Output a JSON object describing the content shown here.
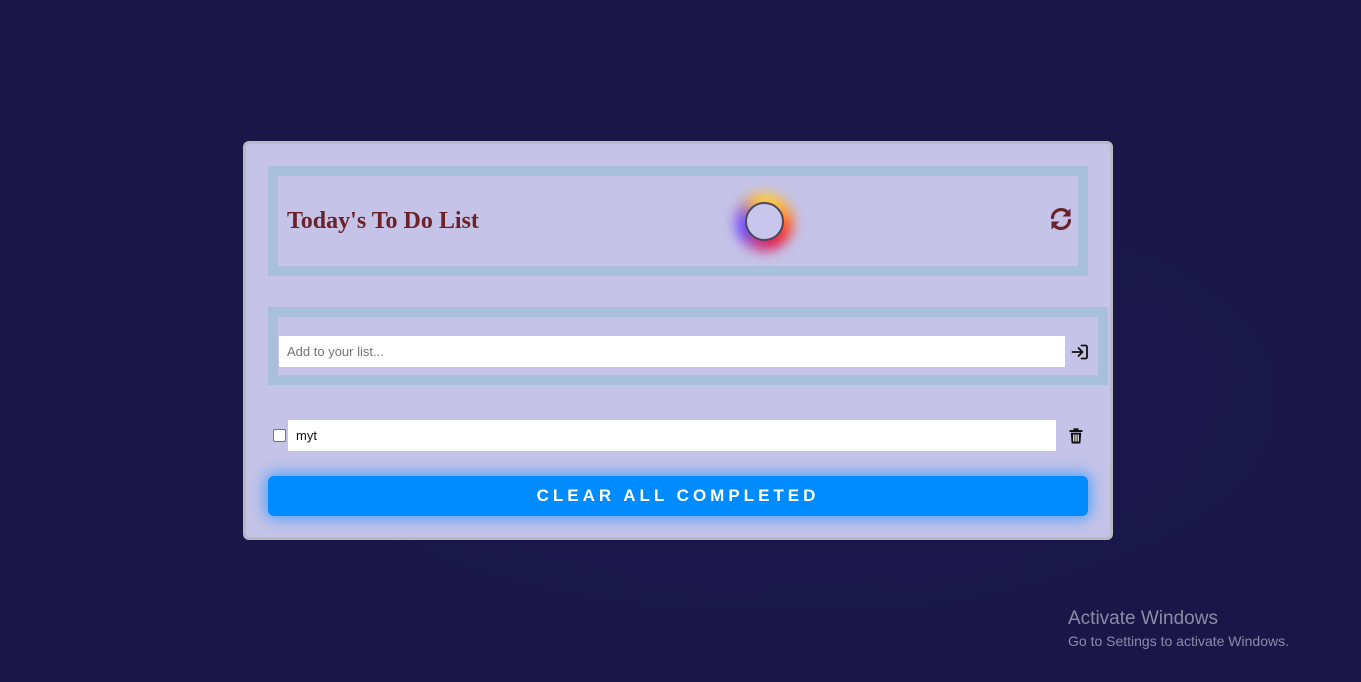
{
  "app": {
    "title": "Today's To Do List"
  },
  "header": {
    "refresh_icon": "refresh-icon",
    "orb_colors": [
      "#ffd33a",
      "#ff3b1f",
      "#e0174f",
      "#6a4cff"
    ]
  },
  "add_form": {
    "placeholder": "Add to your list...",
    "value": "",
    "submit_icon": "sign-in-arrow-icon"
  },
  "todos": [
    {
      "text": "myt",
      "completed": false
    }
  ],
  "actions": {
    "clear_label": "CLEAR ALL COMPLETED",
    "trash_icon": "trash-icon"
  },
  "colors": {
    "background": "#1a1748",
    "card": "#c5c3e8",
    "panel_border": "#a8c0db",
    "title": "#6b2228",
    "accent": "#008cff"
  },
  "watermark": {
    "title": "Activate Windows",
    "subtitle": "Go to Settings to activate Windows."
  }
}
